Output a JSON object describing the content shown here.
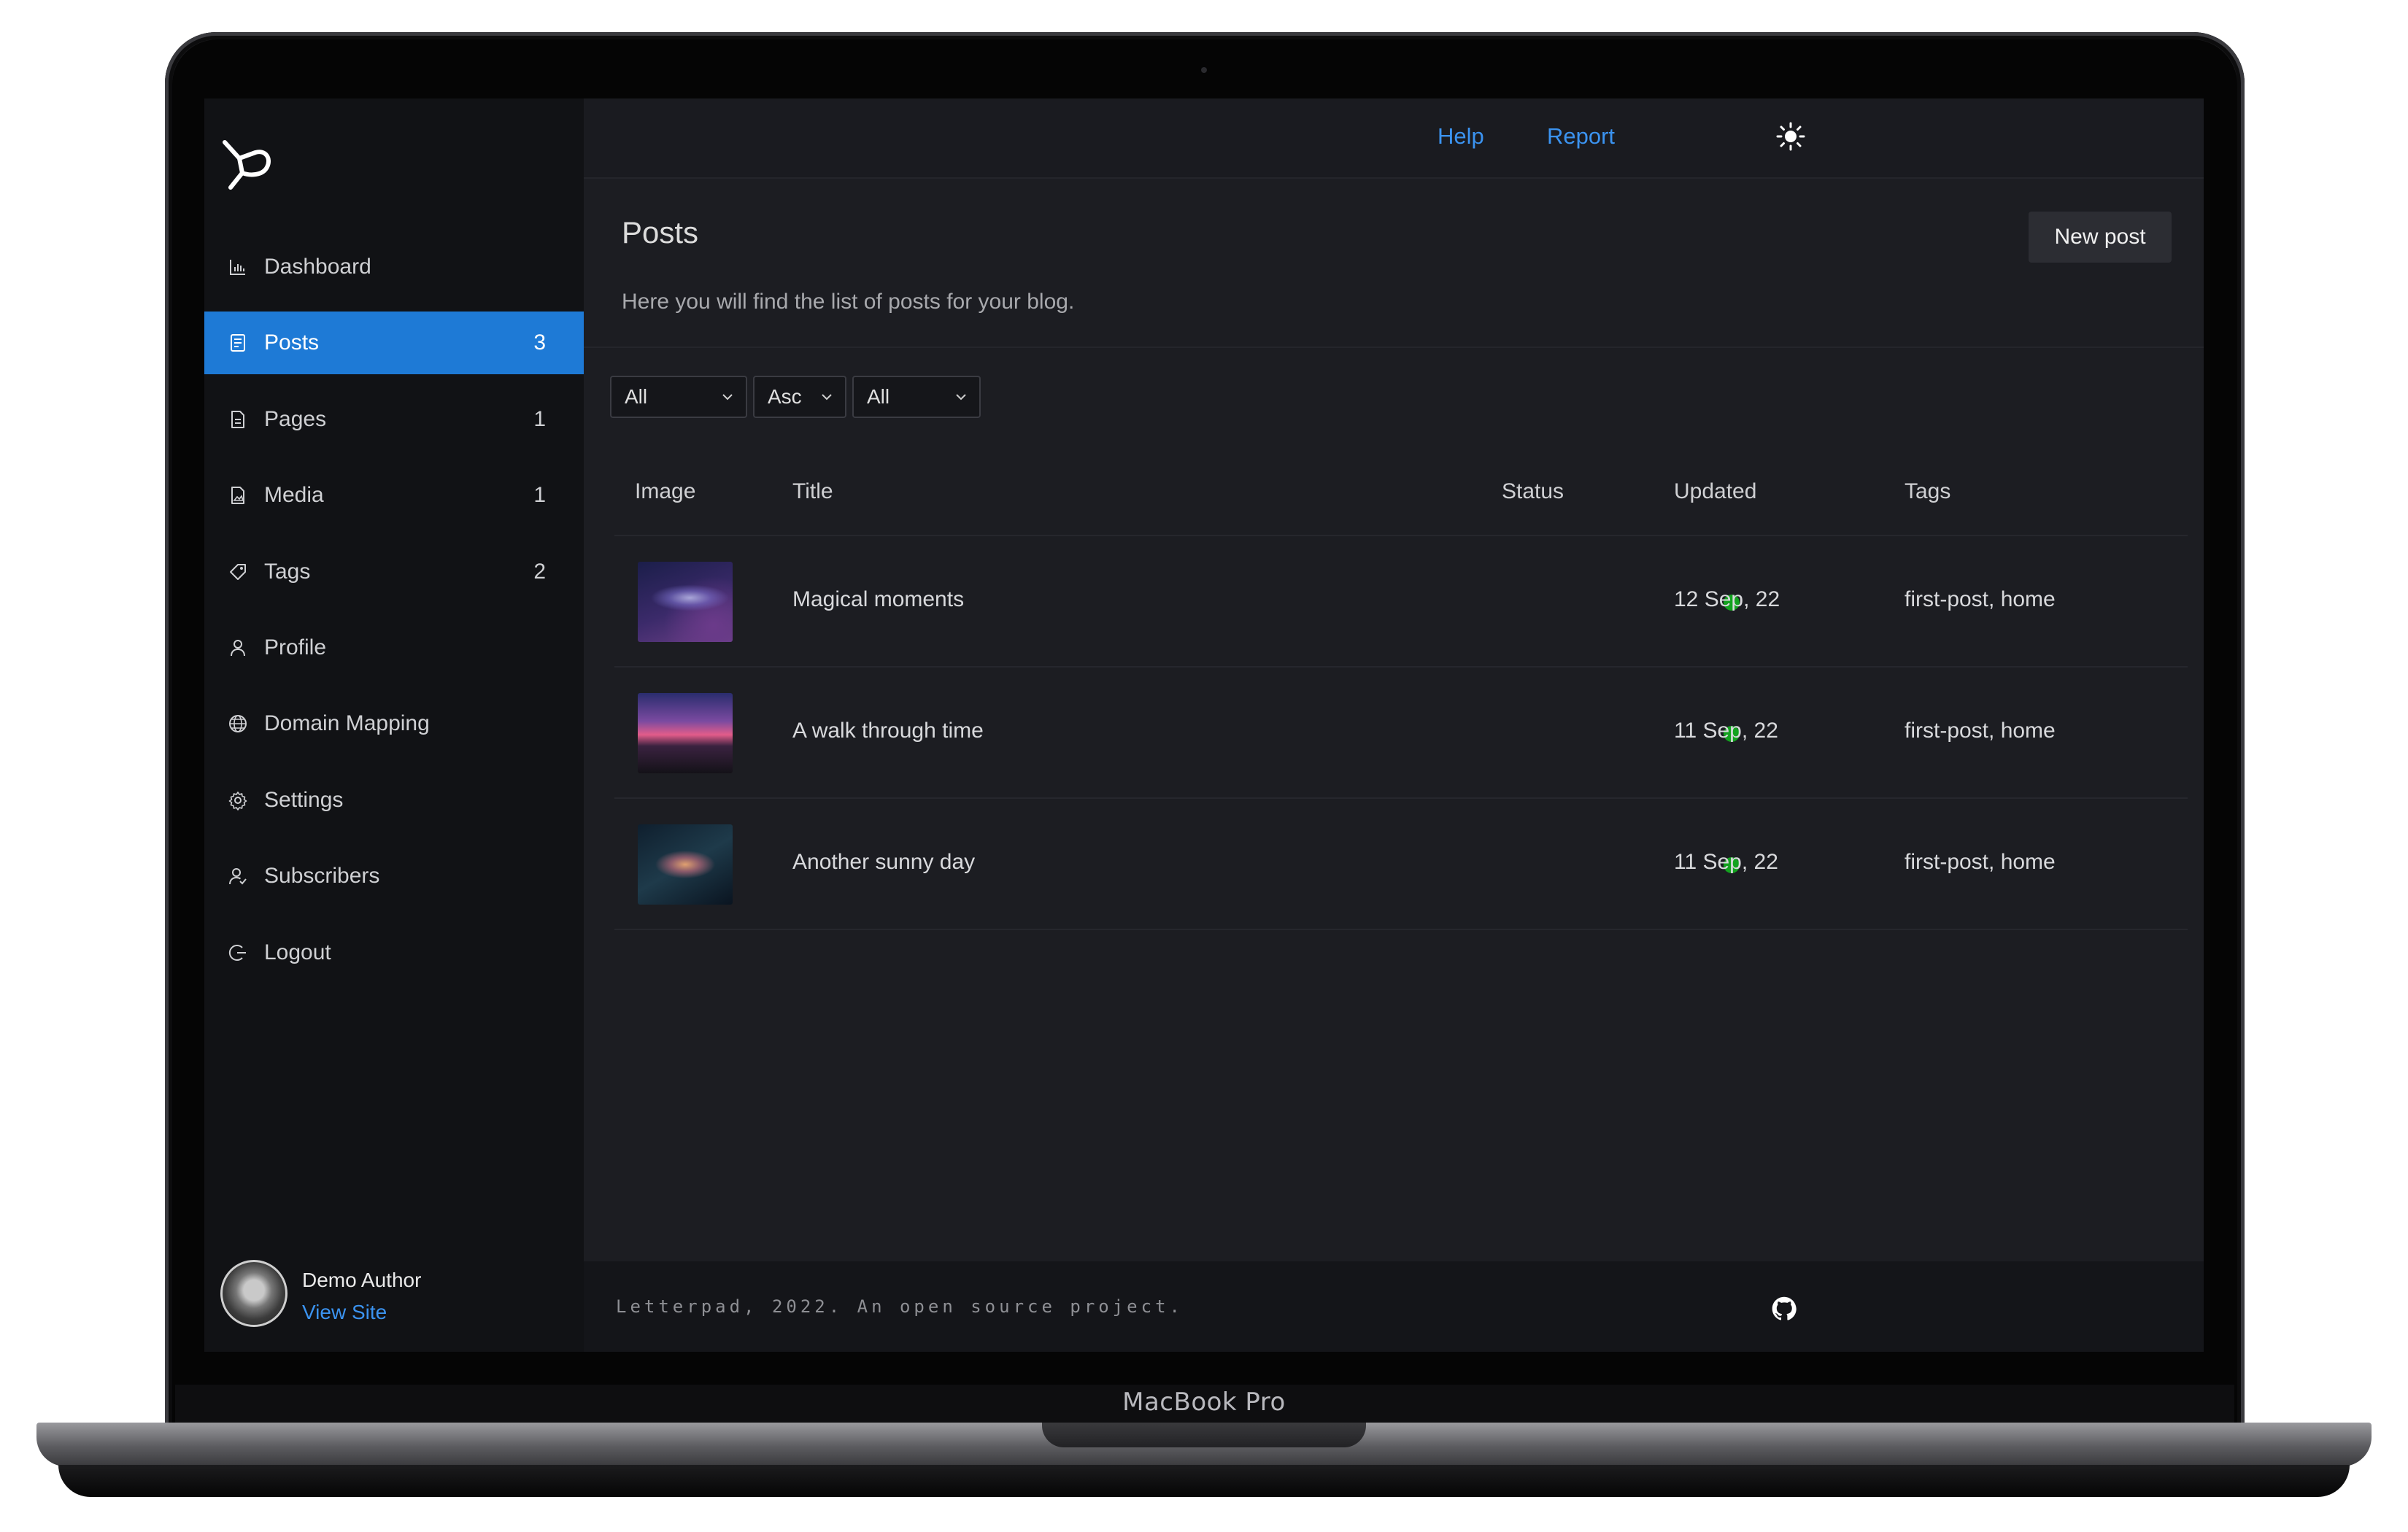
{
  "device": {
    "label": "MacBook Pro"
  },
  "sidebar": {
    "items": [
      {
        "label": "Dashboard",
        "icon": "chart-icon",
        "count": ""
      },
      {
        "label": "Posts",
        "icon": "document-icon",
        "count": "3"
      },
      {
        "label": "Pages",
        "icon": "page-icon",
        "count": "1"
      },
      {
        "label": "Media",
        "icon": "media-icon",
        "count": "1"
      },
      {
        "label": "Tags",
        "icon": "tag-icon",
        "count": "2"
      },
      {
        "label": "Profile",
        "icon": "user-icon",
        "count": ""
      },
      {
        "label": "Domain Mapping",
        "icon": "globe-icon",
        "count": ""
      },
      {
        "label": "Settings",
        "icon": "gear-icon",
        "count": ""
      },
      {
        "label": "Subscribers",
        "icon": "users-icon",
        "count": ""
      },
      {
        "label": "Logout",
        "icon": "logout-icon",
        "count": ""
      }
    ],
    "active_item": "Posts",
    "author": {
      "name": "Demo Author",
      "link": "View Site"
    }
  },
  "topbar": {
    "help": "Help",
    "report": "Report"
  },
  "main": {
    "title": "Posts",
    "subtitle": "Here you will find the list of posts for your blog.",
    "new_post": "New post",
    "filters": [
      "All",
      "Asc",
      "All"
    ],
    "columns": [
      "Image",
      "Title",
      "Status",
      "Updated",
      "Tags"
    ],
    "rows": [
      {
        "title": "Magical moments",
        "status": "published",
        "updated": "12 Sep, 22",
        "tags": "first-post, home"
      },
      {
        "title": "A walk through time",
        "status": "published",
        "updated": "11 Sep, 22",
        "tags": "first-post, home"
      },
      {
        "title": "Another sunny day",
        "status": "published",
        "updated": "11 Sep, 22",
        "tags": "first-post, home"
      }
    ]
  },
  "footer": {
    "text": "Letterpad, 2022. An open source project."
  },
  "colors": {
    "accent": "#1e7ad6",
    "link": "#3b93f0",
    "status_published": "#13a21f",
    "background": "#1c1d22",
    "sidebar": "#111215"
  }
}
